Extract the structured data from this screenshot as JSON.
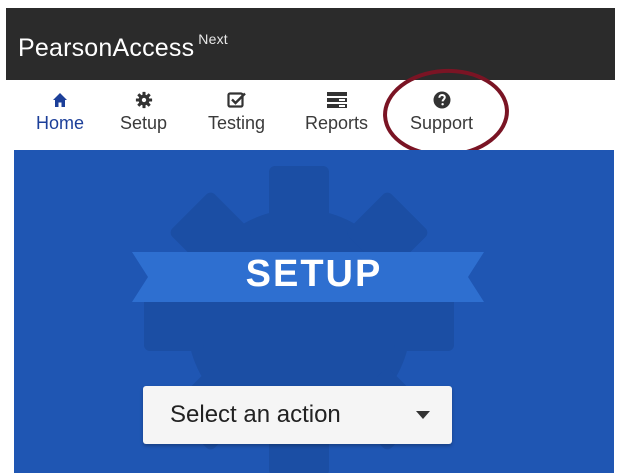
{
  "header": {
    "brand": "PearsonAccess",
    "brand_superscript": "Next"
  },
  "nav": {
    "items": [
      {
        "label": "Home",
        "icon": "home-icon",
        "active": true
      },
      {
        "label": "Setup",
        "icon": "gear-icon",
        "active": false
      },
      {
        "label": "Testing",
        "icon": "checkbox-icon",
        "active": false
      },
      {
        "label": "Reports",
        "icon": "reports-icon",
        "active": false
      },
      {
        "label": "Support",
        "icon": "question-icon",
        "active": false
      }
    ]
  },
  "hero": {
    "title": "SETUP",
    "select": {
      "label": "Select an action"
    }
  },
  "colors": {
    "header_bg": "#2b2b2b",
    "hero_bg": "#1f56b3",
    "ribbon": "#2e6fd0",
    "active_nav": "#1c3f99",
    "annotation_circle": "#7a1424"
  }
}
